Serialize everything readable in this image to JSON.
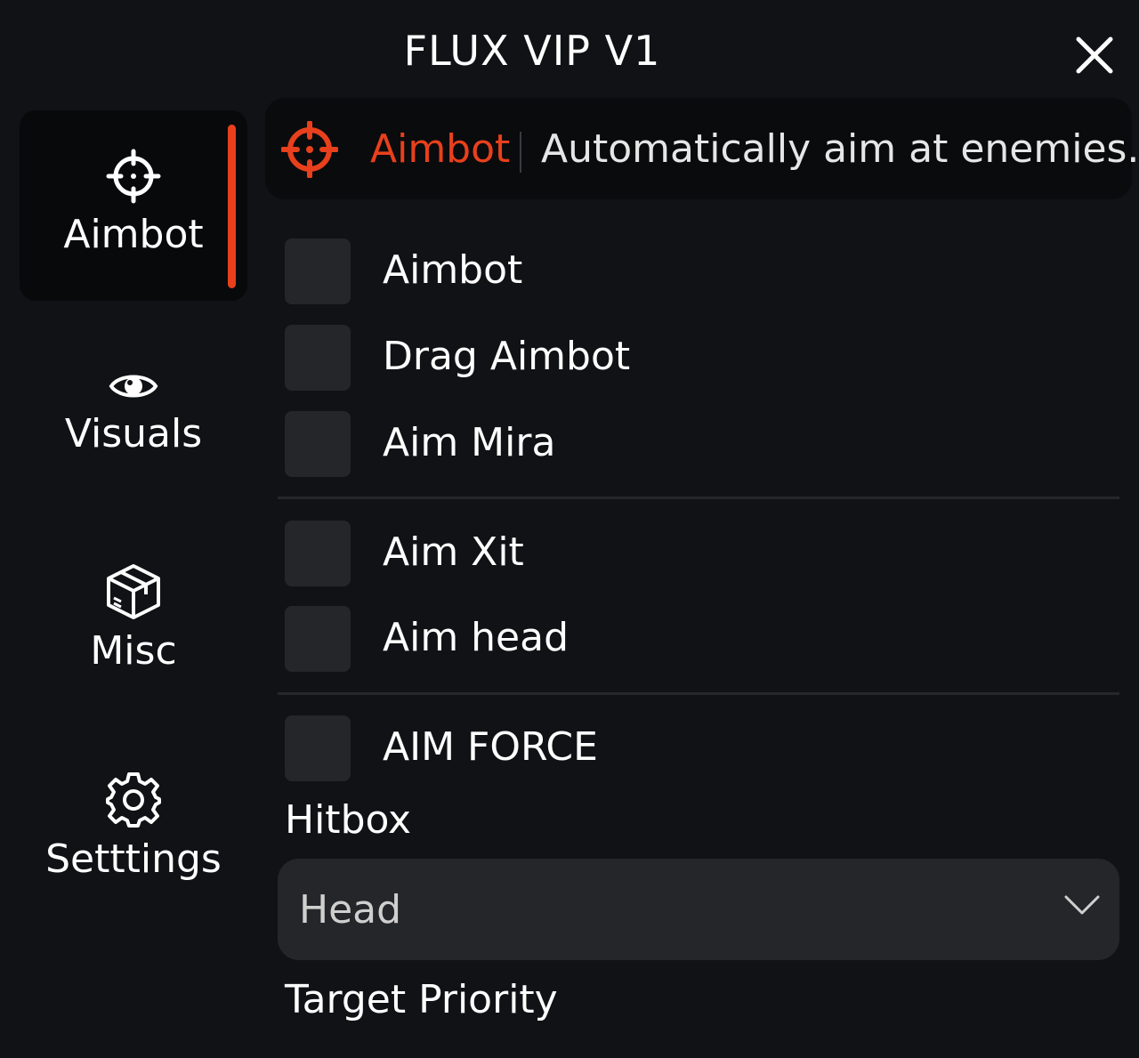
{
  "window": {
    "title": "FLUX VIP V1",
    "close_icon": "close-icon"
  },
  "sidebar": {
    "items": [
      {
        "label": "Aimbot",
        "icon": "crosshair-icon",
        "active": true
      },
      {
        "label": "Visuals",
        "icon": "eye-icon",
        "active": false
      },
      {
        "label": "Misc",
        "icon": "box-icon",
        "active": false
      },
      {
        "label": "Setttings",
        "icon": "gear-icon",
        "active": false
      }
    ]
  },
  "banner": {
    "icon": "crosshair-icon",
    "title": "Aimbot",
    "description": "Automatically aim at enemies."
  },
  "options": [
    {
      "label": "Aimbot",
      "checked": false
    },
    {
      "label": "Drag Aimbot",
      "checked": false
    },
    {
      "label": "Aim Mira",
      "checked": false
    },
    {
      "label": "Aim Xit",
      "checked": false
    },
    {
      "label": "Aim head",
      "checked": false
    },
    {
      "label": "AIM FORCE",
      "checked": false
    }
  ],
  "hitbox": {
    "label": "Hitbox",
    "selected": "Head"
  },
  "target_priority": {
    "label": "Target Priority"
  },
  "colors": {
    "accent": "#e8401c",
    "background": "#111215",
    "control": "#25262a"
  }
}
